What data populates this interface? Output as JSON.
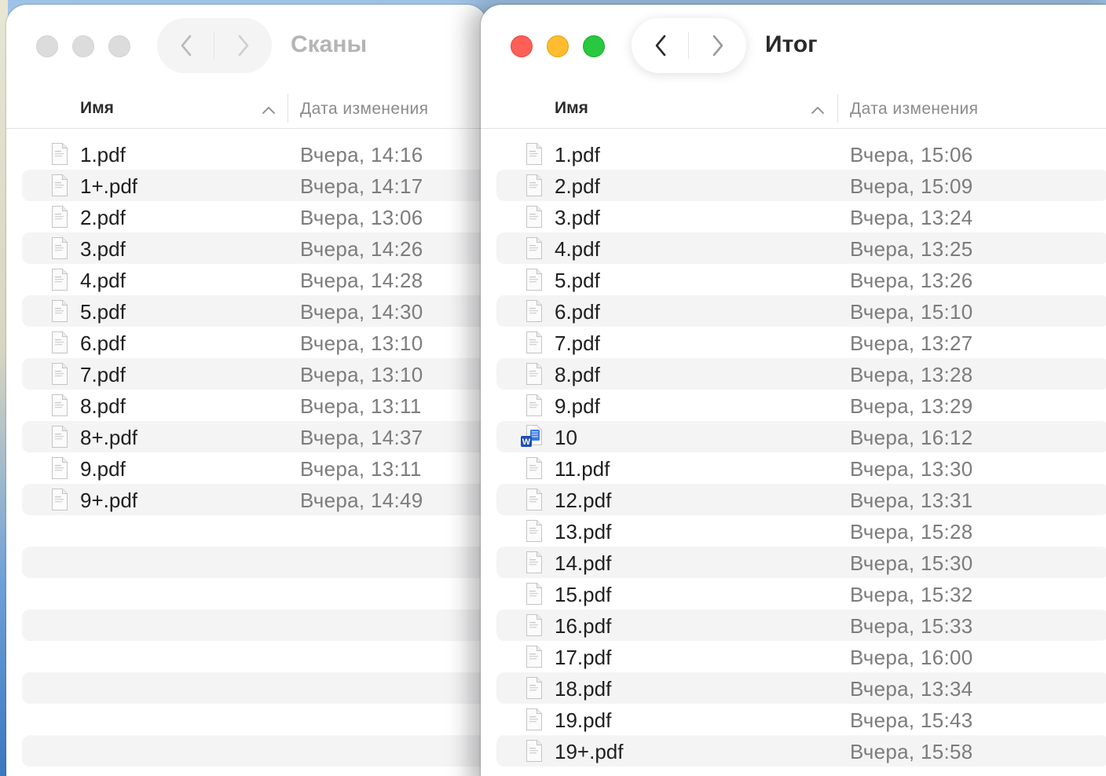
{
  "windows": {
    "scans": {
      "title": "Сканы",
      "column_name": "Имя",
      "column_date": "Дата изменения",
      "files": [
        {
          "name": "1.pdf",
          "date": "Вчера, 14:16",
          "icon": "pdf-file-icon"
        },
        {
          "name": "1+.pdf",
          "date": "Вчера, 14:17",
          "icon": "pdf-file-icon"
        },
        {
          "name": "2.pdf",
          "date": "Вчера, 13:06",
          "icon": "pdf-file-icon"
        },
        {
          "name": "3.pdf",
          "date": "Вчера, 14:26",
          "icon": "pdf-file-icon"
        },
        {
          "name": "4.pdf",
          "date": "Вчера, 14:28",
          "icon": "pdf-file-icon"
        },
        {
          "name": "5.pdf",
          "date": "Вчера, 14:30",
          "icon": "pdf-file-icon"
        },
        {
          "name": "6.pdf",
          "date": "Вчера, 13:10",
          "icon": "pdf-file-icon"
        },
        {
          "name": "7.pdf",
          "date": "Вчера, 13:10",
          "icon": "pdf-file-icon"
        },
        {
          "name": "8.pdf",
          "date": "Вчера, 13:11",
          "icon": "pdf-file-icon"
        },
        {
          "name": "8+.pdf",
          "date": "Вчера, 14:37",
          "icon": "pdf-file-icon"
        },
        {
          "name": "9.pdf",
          "date": "Вчера, 13:11",
          "icon": "pdf-file-icon"
        },
        {
          "name": "9+.pdf",
          "date": "Вчера, 14:49",
          "icon": "pdf-file-icon"
        }
      ]
    },
    "result": {
      "title": "Итог",
      "column_name": "Имя",
      "column_date": "Дата изменения",
      "files": [
        {
          "name": "1.pdf",
          "date": "Вчера, 15:06",
          "icon": "pdf-file-icon"
        },
        {
          "name": "2.pdf",
          "date": "Вчера, 15:09",
          "icon": "pdf-file-icon"
        },
        {
          "name": "3.pdf",
          "date": "Вчера, 13:24",
          "icon": "pdf-file-icon"
        },
        {
          "name": "4.pdf",
          "date": "Вчера, 13:25",
          "icon": "pdf-file-icon"
        },
        {
          "name": "5.pdf",
          "date": "Вчера, 13:26",
          "icon": "pdf-file-icon"
        },
        {
          "name": "6.pdf",
          "date": "Вчера, 15:10",
          "icon": "pdf-file-icon"
        },
        {
          "name": "7.pdf",
          "date": "Вчера, 13:27",
          "icon": "pdf-file-icon"
        },
        {
          "name": "8.pdf",
          "date": "Вчера, 13:28",
          "icon": "pdf-file-icon"
        },
        {
          "name": "9.pdf",
          "date": "Вчера, 13:29",
          "icon": "pdf-file-icon"
        },
        {
          "name": "10",
          "date": "Вчера, 16:12",
          "icon": "word-document-icon"
        },
        {
          "name": "11.pdf",
          "date": "Вчера, 13:30",
          "icon": "pdf-file-icon"
        },
        {
          "name": "12.pdf",
          "date": "Вчера, 13:31",
          "icon": "pdf-file-icon"
        },
        {
          "name": "13.pdf",
          "date": "Вчера, 15:28",
          "icon": "pdf-file-icon"
        },
        {
          "name": "14.pdf",
          "date": "Вчера, 15:30",
          "icon": "pdf-file-icon"
        },
        {
          "name": "15.pdf",
          "date": "Вчера, 15:32",
          "icon": "pdf-file-icon"
        },
        {
          "name": "16.pdf",
          "date": "Вчера, 15:33",
          "icon": "pdf-file-icon"
        },
        {
          "name": "17.pdf",
          "date": "Вчера, 16:00",
          "icon": "pdf-file-icon"
        },
        {
          "name": "18.pdf",
          "date": "Вчера, 13:34",
          "icon": "pdf-file-icon"
        },
        {
          "name": "19.pdf",
          "date": "Вчера, 15:43",
          "icon": "pdf-file-icon"
        },
        {
          "name": "19+.pdf",
          "date": "Вчера, 15:58",
          "icon": "pdf-file-icon"
        }
      ]
    }
  },
  "colors": {
    "close": "#fe5f57",
    "minimize": "#febc2e",
    "zoom": "#28c840",
    "inactive_light": "#dcdcdc",
    "row_stripe": "#f4f4f5"
  }
}
